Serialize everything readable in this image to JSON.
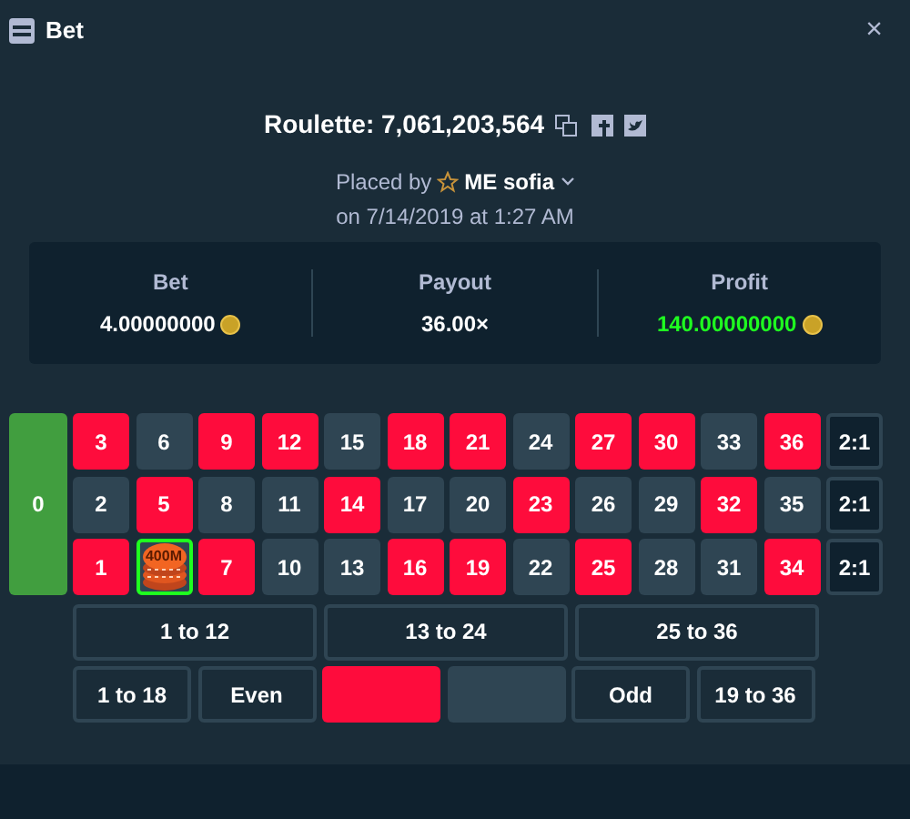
{
  "window": {
    "title": "Bet",
    "close": "×"
  },
  "bet": {
    "title": "Roulette: 7,061,203,564",
    "placed_by": "Placed by",
    "user": "ME sofia",
    "date": "on 7/14/2019 at 1:27 AM"
  },
  "stats": [
    {
      "label": "Bet",
      "value": "4.00000000",
      "coin": true,
      "color": "#ffffff"
    },
    {
      "label": "Payout",
      "value": "36.00×",
      "coin": false,
      "color": "#ffffff"
    },
    {
      "label": "Profit",
      "value": "140.00000000",
      "coin": true,
      "color": "#1fff20"
    }
  ],
  "zero_bet": "0",
  "board": {
    "number_rows": [
      [
        {
          "label": "3",
          "color": "#fe0c3c"
        },
        {
          "label": "6",
          "color": "#2f4553"
        },
        {
          "label": "9",
          "color": "#fe0c3c"
        },
        {
          "label": "12",
          "color": "#fe0c3c"
        },
        {
          "label": "15",
          "color": "#2f4553"
        },
        {
          "label": "18",
          "color": "#fe0c3c"
        },
        {
          "label": "21",
          "color": "#fe0c3c"
        },
        {
          "label": "24",
          "color": "#2f4553"
        },
        {
          "label": "27",
          "color": "#fe0c3c"
        },
        {
          "label": "30",
          "color": "#fe0c3c"
        },
        {
          "label": "33",
          "color": "#2f4553"
        },
        {
          "label": "36",
          "color": "#fe0c3c"
        }
      ],
      [
        {
          "label": "2",
          "color": "#2f4553"
        },
        {
          "label": "5",
          "color": "#fe0c3c"
        },
        {
          "label": "8",
          "color": "#2f4553"
        },
        {
          "label": "11",
          "color": "#2f4553"
        },
        {
          "label": "14",
          "color": "#fe0c3c"
        },
        {
          "label": "17",
          "color": "#2f4553"
        },
        {
          "label": "20",
          "color": "#2f4553"
        },
        {
          "label": "23",
          "color": "#fe0c3c"
        },
        {
          "label": "26",
          "color": "#2f4553"
        },
        {
          "label": "29",
          "color": "#2f4553"
        },
        {
          "label": "32",
          "color": "#fe0c3c"
        },
        {
          "label": "35",
          "color": "#2f4553"
        }
      ],
      [
        {
          "label": "1",
          "color": "#fe0c3c"
        },
        {
          "color": "#2f4553",
          "selected": true,
          "chip": "400M"
        },
        {
          "label": "7",
          "color": "#fe0c3c"
        },
        {
          "label": "10",
          "color": "#2f4553"
        },
        {
          "label": "13",
          "color": "#2f4553"
        },
        {
          "label": "16",
          "color": "#fe0c3c"
        },
        {
          "label": "19",
          "color": "#fe0c3c"
        },
        {
          "label": "22",
          "color": "#2f4553"
        },
        {
          "label": "25",
          "color": "#fe0c3c"
        },
        {
          "label": "28",
          "color": "#2f4553"
        },
        {
          "label": "31",
          "color": "#2f4553"
        },
        {
          "label": "34",
          "color": "#fe0c3c"
        }
      ]
    ],
    "columns": [
      "2:1",
      "2:1",
      "2:1"
    ],
    "dozens": [
      "1 to 12",
      "13 to 24",
      "25 to 36"
    ],
    "outside": [
      {
        "kind": "text",
        "label": "1 to 18"
      },
      {
        "kind": "text",
        "label": "Even"
      },
      {
        "kind": "swatch",
        "color": "#fe0c3c"
      },
      {
        "kind": "swatch",
        "color": "#2f4553"
      },
      {
        "kind": "text",
        "label": "Odd"
      },
      {
        "kind": "text",
        "label": "19 to 36"
      }
    ]
  }
}
